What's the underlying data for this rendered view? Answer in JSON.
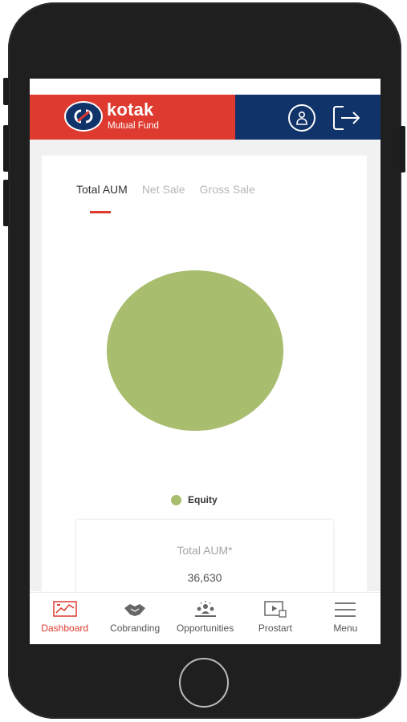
{
  "header": {
    "brand_name": "kotak",
    "brand_sub": "Mutual Fund",
    "profile_icon": "user-icon",
    "logout_icon": "logout-icon"
  },
  "tabs": [
    {
      "label": "Total AUM",
      "active": true
    },
    {
      "label": "Net Sale",
      "active": false
    },
    {
      "label": "Gross Sale",
      "active": false
    }
  ],
  "chart_data": {
    "type": "pie",
    "categories": [
      "Equity"
    ],
    "values": [
      100
    ],
    "colors": [
      "#a8bd6e"
    ],
    "legend_position": "bottom"
  },
  "aum_card": {
    "label": "Total AUM*",
    "value": "36,630"
  },
  "bottom_nav": [
    {
      "label": "Dashboard",
      "icon": "dashboard-icon",
      "active": true
    },
    {
      "label": "Cobranding",
      "icon": "handshake-icon",
      "active": false
    },
    {
      "label": "Opportunities",
      "icon": "opportunities-icon",
      "active": false
    },
    {
      "label": "Prostart",
      "icon": "video-icon",
      "active": false
    },
    {
      "label": "Menu",
      "icon": "hamburger-menu-icon",
      "active": false
    }
  ],
  "colors": {
    "brand_red": "#de3a30",
    "brand_navy": "#10336a",
    "equity": "#a8bd6e"
  }
}
